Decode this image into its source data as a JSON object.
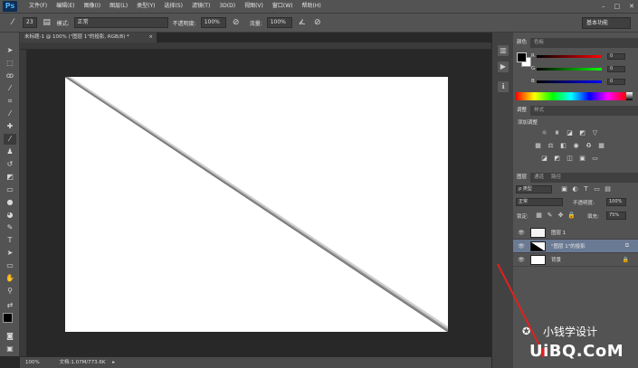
{
  "app": {
    "logo": "Ps"
  },
  "menu": [
    "文件(F)",
    "编辑(E)",
    "图像(I)",
    "图层(L)",
    "类型(Y)",
    "选择(S)",
    "滤镜(T)",
    "3D(D)",
    "视图(V)",
    "窗口(W)",
    "帮助(H)"
  ],
  "window_controls": [
    "–",
    "□",
    "✕"
  ],
  "options": {
    "brush_size": "23",
    "mode_label": "模式:",
    "mode_value": "正常",
    "opacity_label": "不透明度:",
    "opacity_value": "100%",
    "flow_label": "流量:",
    "flow_value": "100%",
    "workspace": "基本功能"
  },
  "document": {
    "tab_title": "未标题-1 @ 100% (\"图层 1\"的投影, RGB/8) *",
    "close": "×"
  },
  "status": {
    "zoom": "100%",
    "doc_info": "文档:1.07M/773.6K"
  },
  "panels": {
    "color_tabs": [
      "颜色",
      "色板"
    ],
    "color_values": {
      "r": "0",
      "g": "0",
      "b": "0"
    },
    "color_letters": {
      "r": "R",
      "g": "G",
      "b": "B"
    },
    "adjust_tabs": [
      "调整",
      "样式"
    ],
    "adjust_title": "添加调整",
    "layers_tabs": [
      "图层",
      "通道",
      "路径"
    ],
    "kind_label": "ρ 类型",
    "blend_mode": "正常",
    "opacity_label": "不透明度:",
    "opacity_value": "100%",
    "lock_label": "锁定:",
    "fill_label": "填充:",
    "fill_value": "75%",
    "layers": [
      {
        "name": "图层 1",
        "selected": false
      },
      {
        "name": "\"图层 1\"的投影",
        "selected": true
      },
      {
        "name": "背景",
        "selected": false
      }
    ]
  },
  "watermark": {
    "text": "小钱学设计",
    "site": "UiBQ.CoM"
  }
}
